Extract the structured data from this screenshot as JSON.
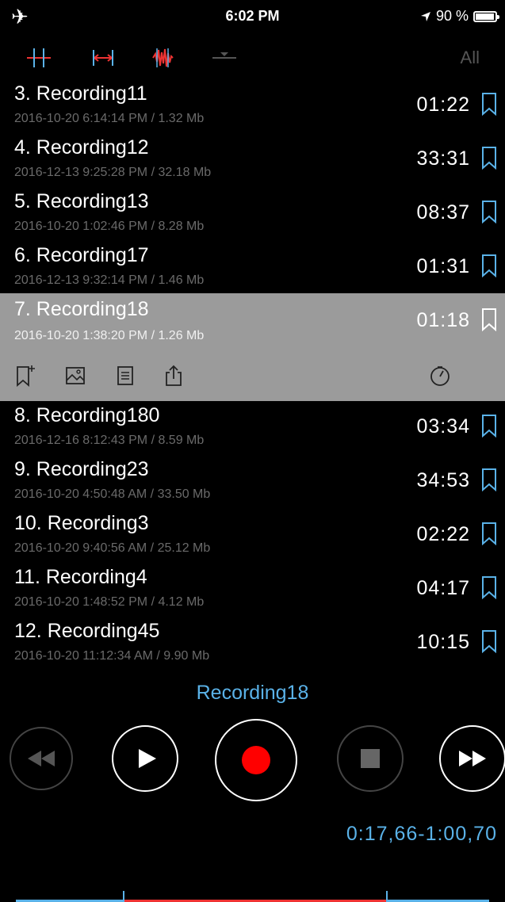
{
  "status_bar": {
    "time": "6:02 PM",
    "battery": "90 %",
    "battery_level": 0.9
  },
  "toolbar": {
    "all_label": "All"
  },
  "recordings": [
    {
      "title": "3. Recording11",
      "meta": "2016-10-20 6:14:14 PM / 1.32 Mb",
      "duration": "01:22"
    },
    {
      "title": "4. Recording12",
      "meta": "2016-12-13 9:25:28 PM / 32.18 Mb",
      "duration": "33:31"
    },
    {
      "title": "5. Recording13",
      "meta": "2016-10-20 1:02:46 PM / 8.28 Mb",
      "duration": "08:37"
    },
    {
      "title": "6. Recording17",
      "meta": "2016-12-13 9:32:14 PM / 1.46 Mb",
      "duration": "01:31"
    },
    {
      "title": "7. Recording18",
      "meta": "2016-10-20 1:38:20 PM / 1.26 Mb",
      "duration": "01:18",
      "selected": true
    },
    {
      "title": "8. Recording180",
      "meta": "2016-12-16 8:12:43 PM / 8.59 Mb",
      "duration": "03:34"
    },
    {
      "title": "9. Recording23",
      "meta": "2016-10-20 4:50:48 AM / 33.50 Mb",
      "duration": "34:53"
    },
    {
      "title": "10. Recording3",
      "meta": "2016-10-20 9:40:56 AM / 25.12 Mb",
      "duration": "02:22"
    },
    {
      "title": "11. Recording4",
      "meta": "2016-10-20 1:48:52 PM / 4.12 Mb",
      "duration": "04:17"
    },
    {
      "title": "12. Recording45",
      "meta": "2016-10-20 11:12:34 AM / 9.90 Mb",
      "duration": "10:15"
    }
  ],
  "player": {
    "now_playing": "Recording18",
    "range": "0:17,66-1:00,70"
  },
  "colors": {
    "accent": "#5ab2e8",
    "record": "#ff0000",
    "selected_row": "#9b9b9b"
  }
}
